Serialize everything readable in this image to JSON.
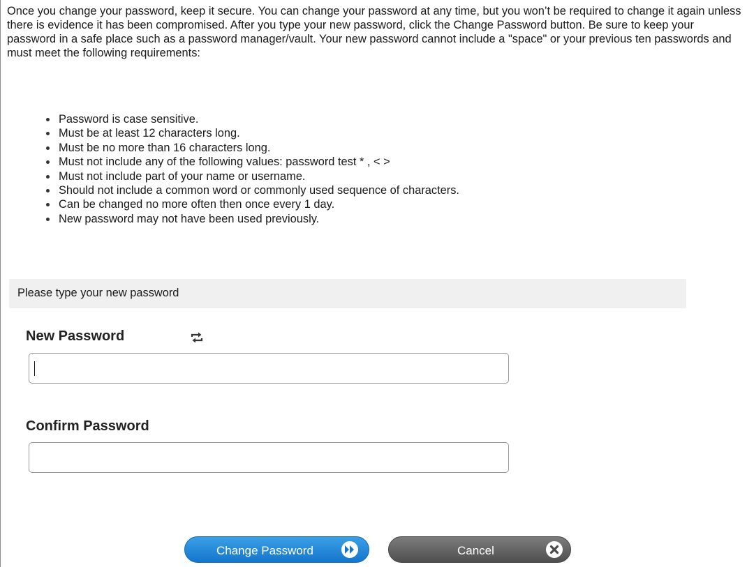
{
  "intro": {
    "text": "Once you change your password, keep it secure. You can change your password at any time, but you won’t be required to change it again unless there is evidence it has been compromised. After you type your new password, click the Change Password button. Be sure to keep your password in a safe place such as a password manager/vault. Your new password cannot include a \"space\" or your previous ten passwords and must meet the following requirements:"
  },
  "requirements": [
    "Password is case sensitive.",
    "Must be at least 12 characters long.",
    "Must be no more than 16 characters long.",
    "Must not include any of the following values: password test * , < >",
    "Must not include part of your name or username.",
    "Should not include a common word or commonly used sequence of characters.",
    "Can be changed no more often then once every 1 day.",
    "New password may not have been used previously."
  ],
  "section": {
    "title": "Please type your new password"
  },
  "fields": {
    "new_password": {
      "label": "New Password",
      "value": "",
      "toggle_icon": "swap-arrows-icon"
    },
    "confirm_password": {
      "label": "Confirm Password",
      "value": ""
    }
  },
  "buttons": {
    "change_password": {
      "label": "Change Password",
      "icon": "double-chevron-right-icon",
      "color": "#1a80d6"
    },
    "cancel": {
      "label": "Cancel",
      "icon": "close-icon",
      "color": "#5e5e5e"
    }
  }
}
